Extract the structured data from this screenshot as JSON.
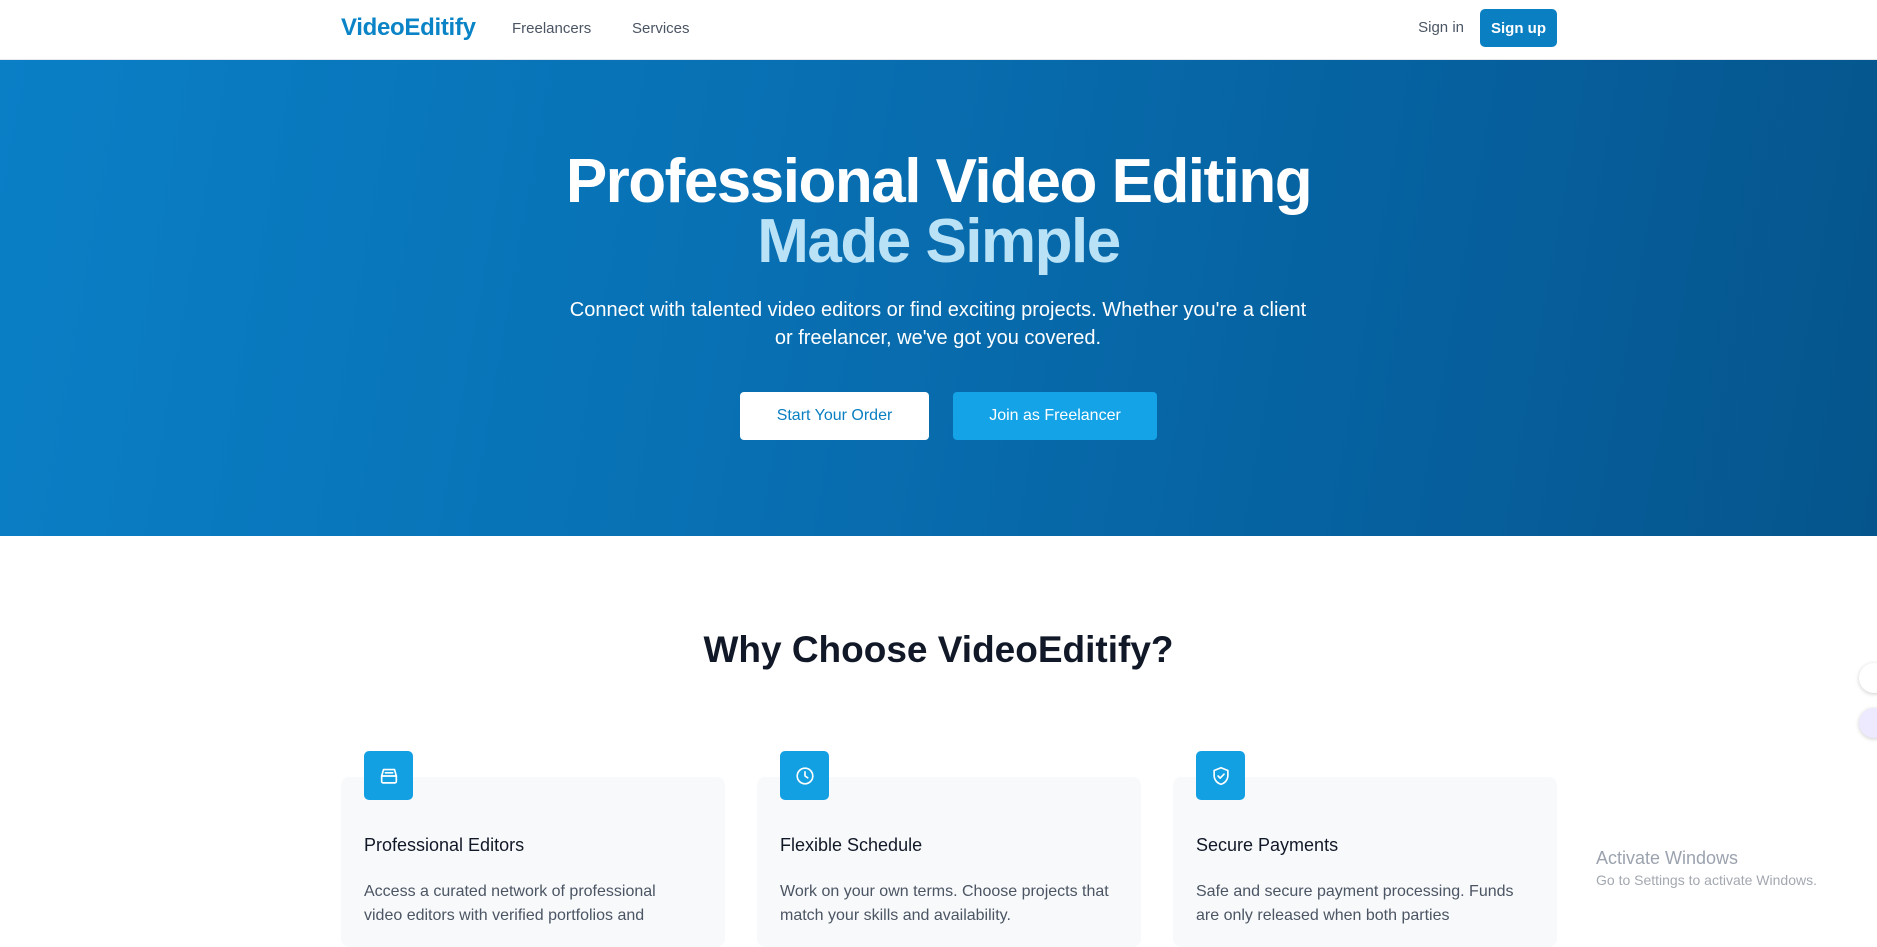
{
  "nav": {
    "logo": "VideoEditify",
    "links": [
      "Freelancers",
      "Services"
    ],
    "signin": "Sign in",
    "signup": "Sign up"
  },
  "hero": {
    "title_line1": "Professional Video Editing",
    "title_line2": "Made Simple",
    "subtitle": "Connect with talented video editors or find exciting projects. Whether you're a client or freelancer, we've got you covered.",
    "primary_button": "Start Your Order",
    "secondary_button": "Join as Freelancer"
  },
  "features": {
    "heading": "Why Choose VideoEditify?",
    "cards": [
      {
        "icon": "inbox-stack-icon",
        "title": "Professional Editors",
        "text": "Access a curated network of professional video editors with verified portfolios and"
      },
      {
        "icon": "clock-icon",
        "title": "Flexible Schedule",
        "text": "Work on your own terms. Choose projects that match your skills and availability."
      },
      {
        "icon": "shield-check-icon",
        "title": "Secure Payments",
        "text": "Safe and secure payment processing. Funds are only released when both parties"
      }
    ]
  },
  "watermark": {
    "line1": "Activate Windows",
    "line2": "Go to Settings to activate Windows."
  },
  "colors": {
    "brand": "#0a84c6",
    "hero_start": "#0a7fc6",
    "hero_end": "#05558c",
    "accent_text": "#bae2f7",
    "icon_bg": "#13a0e2"
  }
}
